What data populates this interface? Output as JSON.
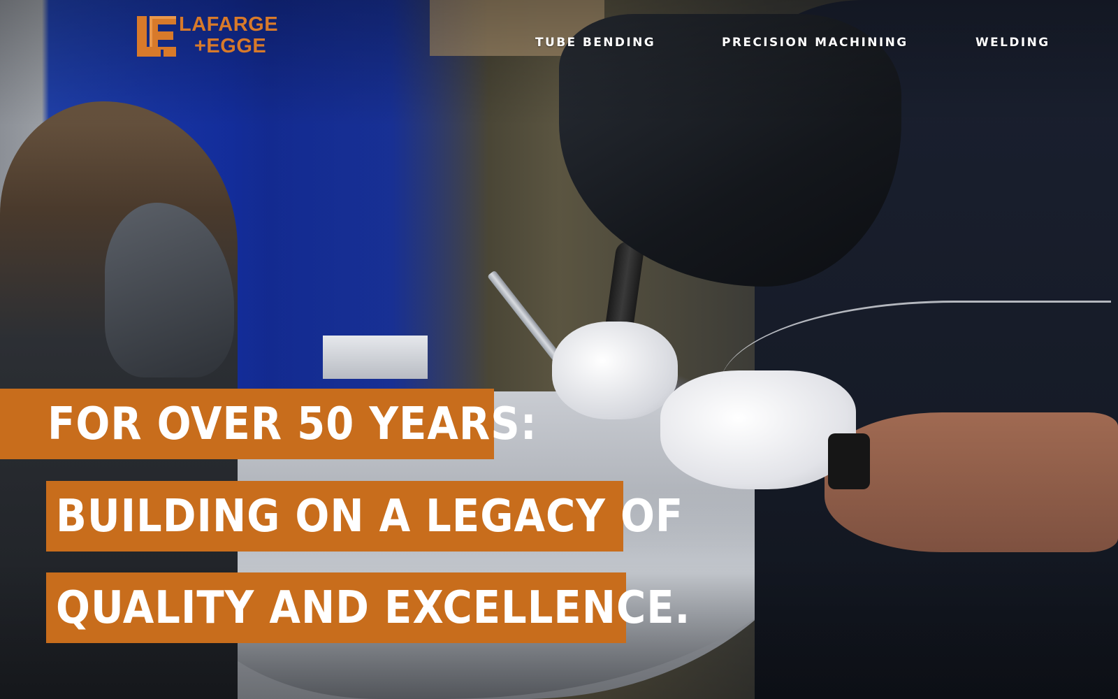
{
  "logo": {
    "line1": "LAFARGE",
    "line2": "+EGGE",
    "mark_letters": "LE",
    "brand_color": "#d87a2a"
  },
  "nav": {
    "items": [
      {
        "label": "TUBE BENDING"
      },
      {
        "label": "PRECISION MACHINING"
      },
      {
        "label": "WELDING"
      }
    ]
  },
  "hero": {
    "headline_lines": [
      "FOR OVER 50 YEARS:",
      "BUILDING ON A LEGACY OF",
      "QUALITY AND EXCELLENCE."
    ],
    "accent_color": "#c86d1c"
  }
}
